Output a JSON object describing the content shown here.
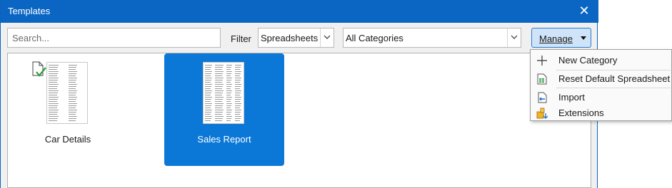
{
  "window": {
    "title": "Templates",
    "close_symbol": "✕"
  },
  "toolbar": {
    "search_placeholder": "Search...",
    "filter_label": "Filter",
    "type_filter": "Spreadsheets",
    "category_filter": "All Categories",
    "manage_label": "Manage"
  },
  "templates": [
    {
      "name": "Car Details",
      "selected": false
    },
    {
      "name": "Sales Report",
      "selected": true
    }
  ],
  "manage_menu": {
    "items": [
      {
        "label": "New Category",
        "icon": "plus-icon"
      },
      {
        "label": "Reset Default Spreadsheet",
        "icon": "spreadsheet-icon"
      },
      {
        "label": "Import",
        "icon": "import-icon"
      },
      {
        "label": "Extensions",
        "icon": "extensions-icon"
      }
    ]
  },
  "colors": {
    "titlebar": "#0b66c3",
    "selection": "#0b78d7",
    "manage_button": "#cfe4f8"
  }
}
